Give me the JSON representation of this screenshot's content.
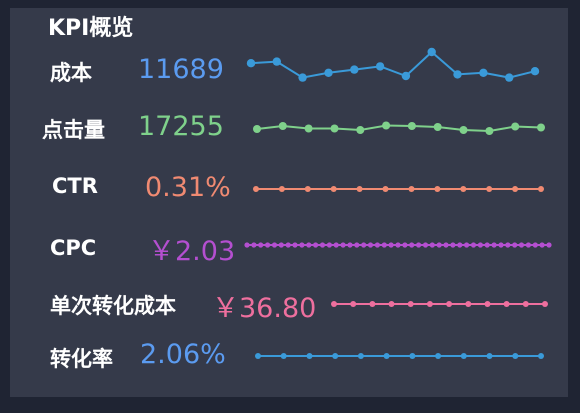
{
  "title": "KPI概览",
  "kpis": [
    {
      "label": "成本",
      "value": "11689",
      "color": "#5b9bf0",
      "line_color": "#3a9ad9",
      "trend": [
        0.65,
        0.7,
        0.2,
        0.35,
        0.45,
        0.55,
        0.25,
        1.0,
        0.3,
        0.35,
        0.2,
        0.4
      ]
    },
    {
      "label": "点击量",
      "value": "17255",
      "color": "#7fd18b",
      "line_color": "#7fd18b",
      "trend": [
        0.4,
        0.7,
        0.45,
        0.45,
        0.3,
        0.75,
        0.7,
        0.6,
        0.3,
        0.2,
        0.65,
        0.55
      ]
    },
    {
      "label": "CTR",
      "value": "0.31%",
      "color": "#f08a72",
      "line_color": "#f08a72",
      "trend": [
        0.5,
        0.5,
        0.5,
        0.5,
        0.5,
        0.5,
        0.5,
        0.5,
        0.5,
        0.5,
        0.5,
        0.5
      ]
    },
    {
      "label": "CPC",
      "value": "￥2.03",
      "color": "#b44fd0",
      "line_color": "#b44fd0",
      "trend": [
        0.5,
        0.5,
        0.5,
        0.5,
        0.5,
        0.5,
        0.5,
        0.5,
        0.5,
        0.5,
        0.5,
        0.5,
        0.5,
        0.5,
        0.5,
        0.5,
        0.5,
        0.5,
        0.5,
        0.5,
        0.5,
        0.5,
        0.5,
        0.5,
        0.5,
        0.5,
        0.5,
        0.5,
        0.5,
        0.5,
        0.5,
        0.5,
        0.5,
        0.5,
        0.5,
        0.5,
        0.5,
        0.5,
        0.5,
        0.5,
        0.5,
        0.5,
        0.5,
        0.5,
        0.5
      ]
    },
    {
      "label": "单次转化成本",
      "value": "￥36.80",
      "color": "#ee6f9e",
      "line_color": "#ee6f9e",
      "trend": [
        0.5,
        0.5,
        0.5,
        0.5,
        0.5,
        0.5,
        0.5,
        0.5,
        0.5,
        0.5,
        0.5,
        0.5
      ]
    },
    {
      "label": "转化率",
      "value": "2.06%",
      "color": "#5b9bf0",
      "line_color": "#3a9ad9",
      "trend": [
        0.5,
        0.5,
        0.5,
        0.5,
        0.5,
        0.5,
        0.5,
        0.5,
        0.5,
        0.5,
        0.5,
        0.5
      ]
    }
  ]
}
